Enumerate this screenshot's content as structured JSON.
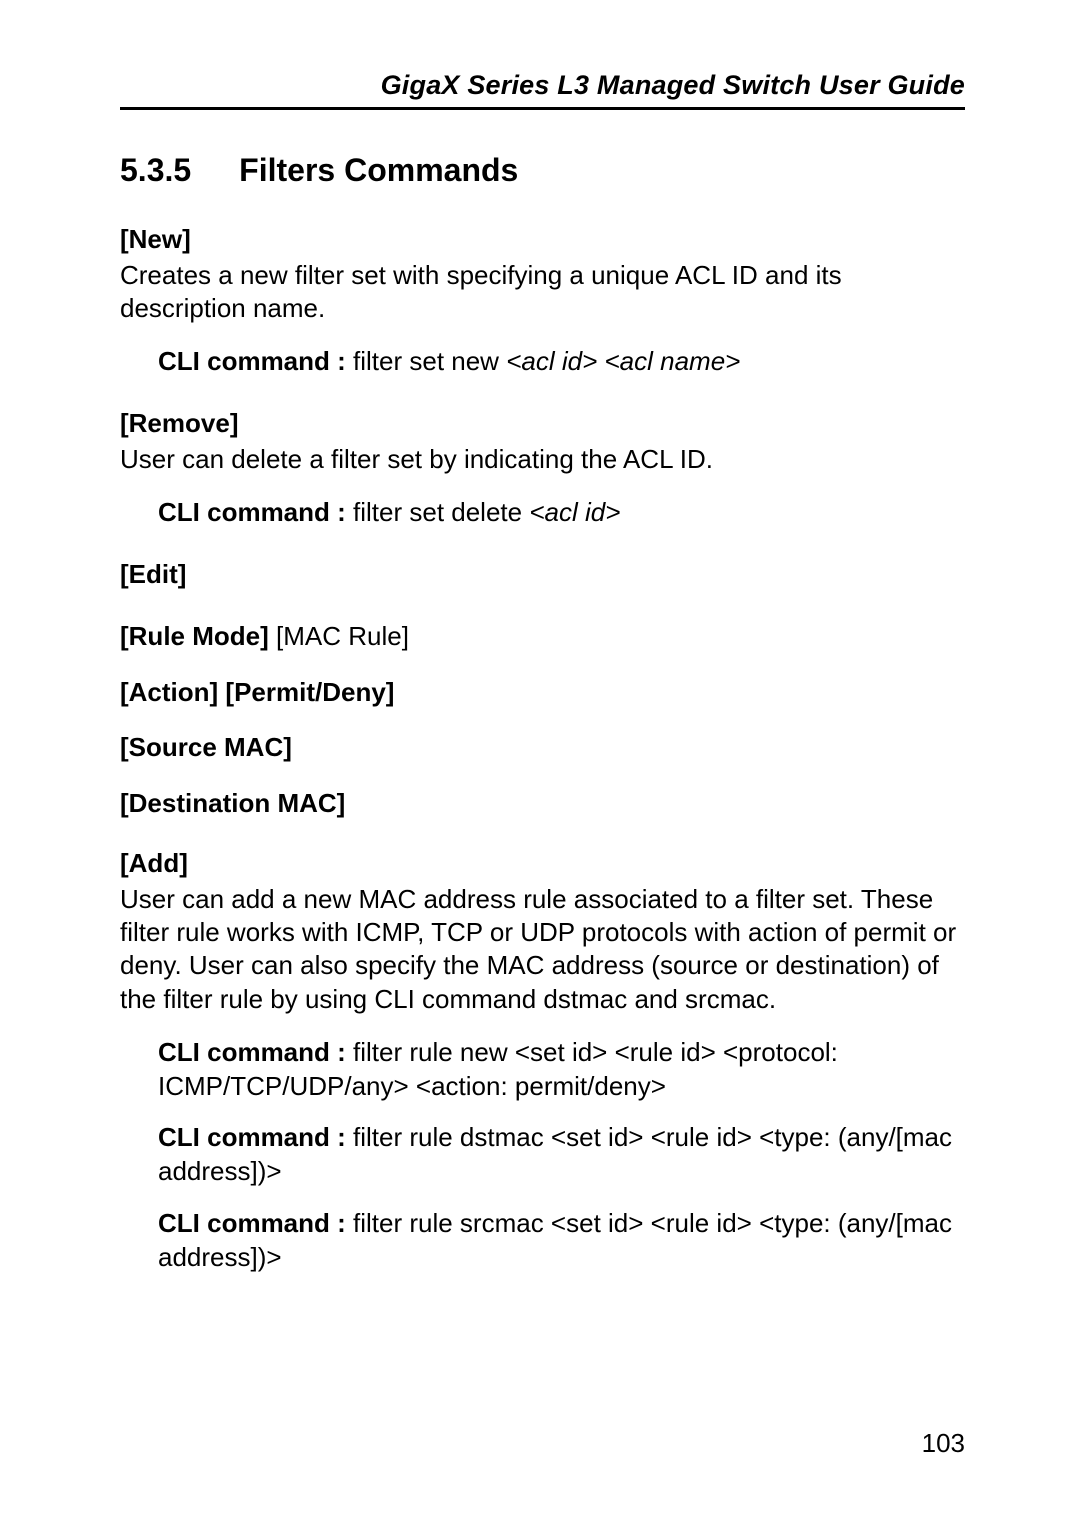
{
  "header": {
    "running_title": "GigaX Series L3 Managed Switch User Guide"
  },
  "section": {
    "number": "5.3.5",
    "title": "Filters Commands"
  },
  "commands": {
    "new": {
      "title": "[New]",
      "desc": "Creates a new filter set with specifying a unique ACL ID and its description name.",
      "cli_label": "CLI command : ",
      "cli_cmd": "filter set new ",
      "cli_args": "<acl id> <acl name>"
    },
    "remove": {
      "title": "[Remove]",
      "desc": "User can delete a filter set by indicating the ACL ID.",
      "cli_label": "CLI command : ",
      "cli_cmd": "filter set delete ",
      "cli_args": "<acl id>"
    },
    "edit": {
      "title": "[Edit]"
    },
    "rule_mode": {
      "title": "[Rule Mode] ",
      "value": "[MAC Rule]"
    },
    "action": {
      "title": "[Action] [Permit/Deny]"
    },
    "source_mac": {
      "title": "[Source MAC]"
    },
    "dest_mac": {
      "title": "[Destination MAC]"
    },
    "add": {
      "title": "[Add]",
      "desc": "User can add a new MAC address rule associated to a filter set. These filter rule works with ICMP, TCP or UDP protocols with action of permit or deny. User can also specify the MAC address (source or destination) of the filter rule by using CLI command dstmac and srcmac.",
      "cli1_label": "CLI command : ",
      "cli1_cmd": "filter rule new <set id> <rule id> <protocol: ICMP/TCP/UDP/any> <action: permit/deny>",
      "cli2_label": "CLI command : ",
      "cli2_cmd": "filter rule dstmac <set id> <rule id> <type: (any/[mac address])>",
      "cli3_label": "CLI command : ",
      "cli3_cmd": "filter rule srcmac <set id> <rule id> <type: (any/[mac address])>"
    }
  },
  "page_number": "103"
}
